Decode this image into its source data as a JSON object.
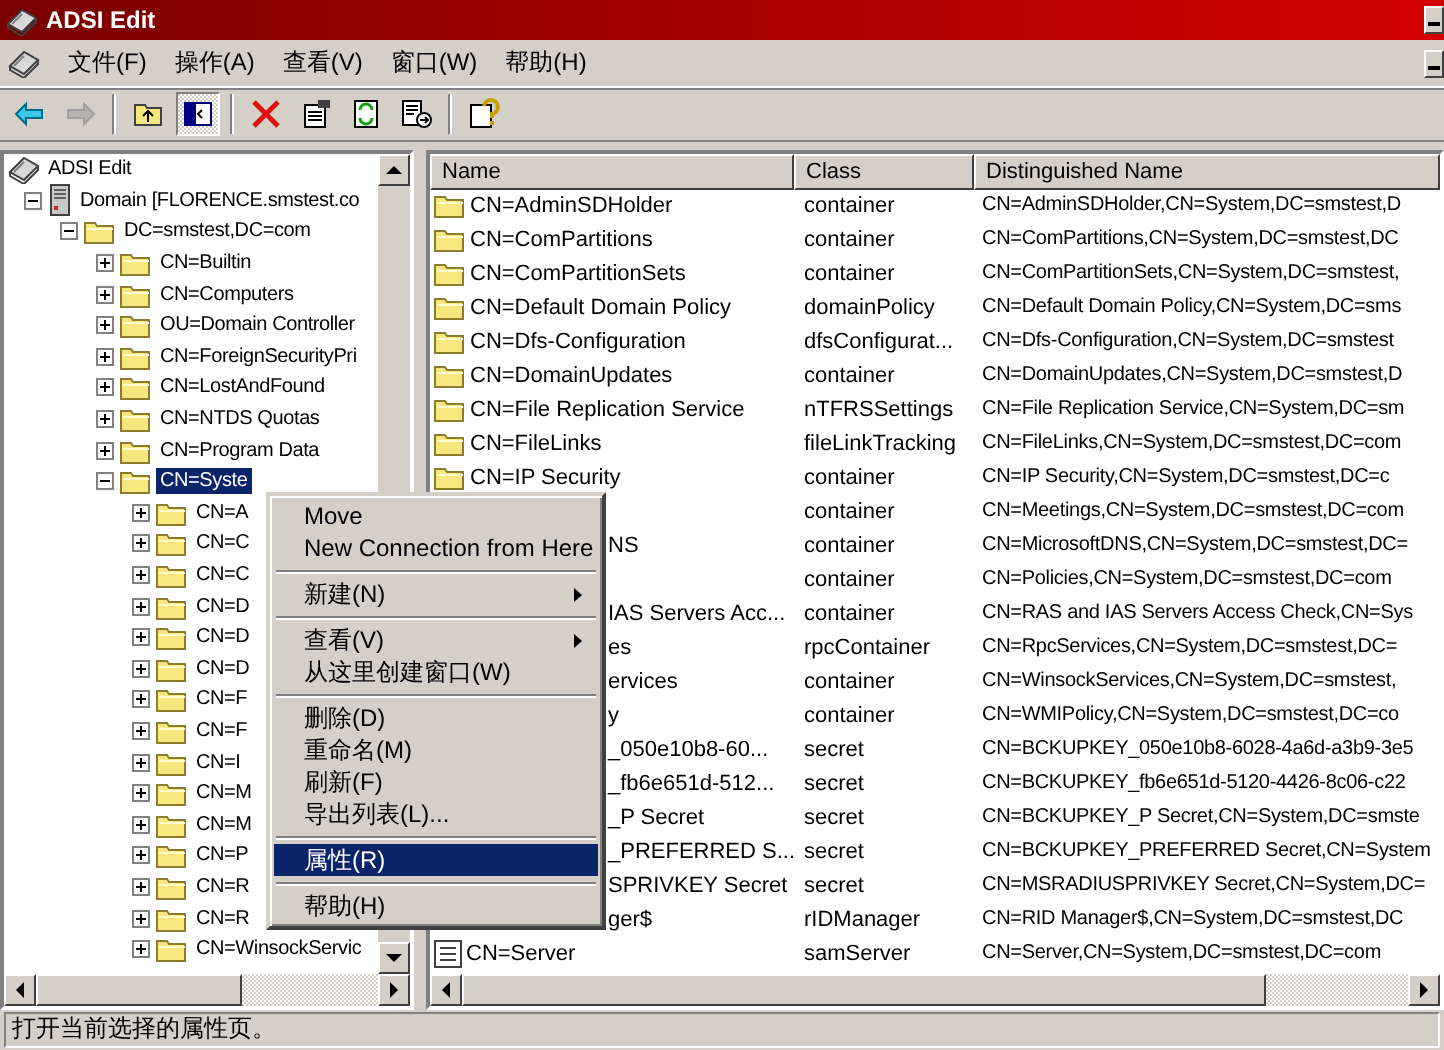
{
  "window": {
    "title": "ADSI Edit"
  },
  "menu_bar": [
    {
      "label": "文件(F)"
    },
    {
      "label": "操作(A)"
    },
    {
      "label": "查看(V)"
    },
    {
      "label": "窗口(W)"
    },
    {
      "label": "帮助(H)"
    }
  ],
  "toolbar": [
    {
      "kind": "back",
      "disabled": false
    },
    {
      "kind": "forward",
      "disabled": true
    },
    {
      "kind": "separator"
    },
    {
      "kind": "up",
      "disabled": false
    },
    {
      "kind": "tree-toggle",
      "disabled": false,
      "pressed": true
    },
    {
      "kind": "separator"
    },
    {
      "kind": "delete",
      "disabled": false
    },
    {
      "kind": "properties",
      "disabled": false
    },
    {
      "kind": "refresh",
      "disabled": false
    },
    {
      "kind": "export",
      "disabled": false
    },
    {
      "kind": "separator"
    },
    {
      "kind": "help",
      "disabled": false
    }
  ],
  "tree": [
    {
      "label": "ADSI Edit",
      "kind": "console",
      "selected": false,
      "children": [
        {
          "label": "Domain [FLORENCE.smstest.co",
          "kind": "server",
          "selected": false,
          "expanded": true,
          "children": [
            {
              "label": "DC=smstest,DC=com",
              "kind": "folder",
              "selected": false,
              "expanded": true,
              "children": [
                {
                  "label": "CN=Builtin",
                  "kind": "folder",
                  "selected": false,
                  "expanded": false
                },
                {
                  "label": "CN=Computers",
                  "kind": "folder",
                  "selected": false,
                  "expanded": false
                },
                {
                  "label": "OU=Domain Controller",
                  "kind": "folder",
                  "selected": false,
                  "expanded": false
                },
                {
                  "label": "CN=ForeignSecurityPri",
                  "kind": "folder",
                  "selected": false,
                  "expanded": false
                },
                {
                  "label": "CN=LostAndFound",
                  "kind": "folder",
                  "selected": false,
                  "expanded": false
                },
                {
                  "label": "CN=NTDS Quotas",
                  "kind": "folder",
                  "selected": false,
                  "expanded": false
                },
                {
                  "label": "CN=Program Data",
                  "kind": "folder",
                  "selected": false,
                  "expanded": false
                },
                {
                  "label": "CN=Syste",
                  "kind": "folder",
                  "selected": true,
                  "expanded": true,
                  "children": [
                    {
                      "label": "CN=A",
                      "kind": "folder",
                      "selected": false,
                      "expanded": false
                    },
                    {
                      "label": "CN=C",
                      "kind": "folder",
                      "selected": false,
                      "expanded": false
                    },
                    {
                      "label": "CN=C",
                      "kind": "folder",
                      "selected": false,
                      "expanded": false
                    },
                    {
                      "label": "CN=D",
                      "kind": "folder",
                      "selected": false,
                      "expanded": false
                    },
                    {
                      "label": "CN=D",
                      "kind": "folder",
                      "selected": false,
                      "expanded": false
                    },
                    {
                      "label": "CN=D",
                      "kind": "folder",
                      "selected": false,
                      "expanded": false
                    },
                    {
                      "label": "CN=F",
                      "kind": "folder",
                      "selected": false,
                      "expanded": false
                    },
                    {
                      "label": "CN=F",
                      "kind": "folder",
                      "selected": false,
                      "expanded": false
                    },
                    {
                      "label": "CN=I",
                      "kind": "folder",
                      "selected": false,
                      "expanded": false
                    },
                    {
                      "label": "CN=M",
                      "kind": "folder",
                      "selected": false,
                      "expanded": false
                    },
                    {
                      "label": "CN=M",
                      "kind": "folder",
                      "selected": false,
                      "expanded": false
                    },
                    {
                      "label": "CN=P",
                      "kind": "folder",
                      "selected": false,
                      "expanded": false
                    },
                    {
                      "label": "CN=R",
                      "kind": "folder",
                      "selected": false,
                      "expanded": false
                    },
                    {
                      "label": "CN=R",
                      "kind": "folder",
                      "selected": false,
                      "expanded": false
                    },
                    {
                      "label": "CN=WinsockServic",
                      "kind": "folder",
                      "selected": false,
                      "expanded": false
                    }
                  ]
                }
              ]
            }
          ]
        }
      ]
    }
  ],
  "table": {
    "columns": [
      "Name",
      "Class",
      "Distinguished Name"
    ],
    "rows": [
      {
        "kind": "folder",
        "covered": false,
        "selected": false,
        "name": "CN=AdminSDHolder",
        "class": "container",
        "dn": "CN=AdminSDHolder,CN=System,DC=smstest,D"
      },
      {
        "kind": "folder",
        "covered": false,
        "selected": false,
        "name": "CN=ComPartitions",
        "class": "container",
        "dn": "CN=ComPartitions,CN=System,DC=smstest,DC"
      },
      {
        "kind": "folder",
        "covered": false,
        "selected": false,
        "name": "CN=ComPartitionSets",
        "class": "container",
        "dn": "CN=ComPartitionSets,CN=System,DC=smstest,"
      },
      {
        "kind": "folder",
        "covered": false,
        "selected": false,
        "name": "CN=Default Domain Policy",
        "class": "domainPolicy",
        "dn": "CN=Default Domain Policy,CN=System,DC=sms"
      },
      {
        "kind": "folder",
        "covered": false,
        "selected": false,
        "name": "CN=Dfs-Configuration",
        "class": "dfsConfigurat...",
        "dn": "CN=Dfs-Configuration,CN=System,DC=smstest"
      },
      {
        "kind": "folder",
        "covered": false,
        "selected": false,
        "name": "CN=DomainUpdates",
        "class": "container",
        "dn": "CN=DomainUpdates,CN=System,DC=smstest,D"
      },
      {
        "kind": "folder",
        "covered": false,
        "selected": false,
        "name": "CN=File Replication Service",
        "class": "nTFRSSettings",
        "dn": "CN=File Replication Service,CN=System,DC=sm"
      },
      {
        "kind": "folder",
        "covered": false,
        "selected": false,
        "name": "CN=FileLinks",
        "class": "fileLinkTracking",
        "dn": "CN=FileLinks,CN=System,DC=smstest,DC=com"
      },
      {
        "kind": "folder",
        "covered": false,
        "selected": false,
        "name": "CN=IP Security",
        "class": "container",
        "dn": "CN=IP Security,CN=System,DC=smstest,DC=c"
      },
      {
        "selected": false,
        "class": "container",
        "dn": "CN=Meetings,CN=System,DC=smstest,DC=com"
      },
      {
        "covered": true,
        "selected": false,
        "name": "NS",
        "class": "container",
        "dn": "CN=MicrosoftDNS,CN=System,DC=smstest,DC="
      },
      {
        "selected": false,
        "class": "container",
        "dn": "CN=Policies,CN=System,DC=smstest,DC=com"
      },
      {
        "covered": true,
        "selected": false,
        "name": "IAS Servers Acc...",
        "class": "container",
        "dn": "CN=RAS and IAS Servers Access Check,CN=Sys"
      },
      {
        "covered": true,
        "selected": false,
        "name": "es",
        "class": "rpcContainer",
        "dn": "CN=RpcServices,CN=System,DC=smstest,DC="
      },
      {
        "covered": true,
        "selected": false,
        "name": "ervices",
        "class": "container",
        "dn": "CN=WinsockServices,CN=System,DC=smstest,"
      },
      {
        "covered": true,
        "selected": false,
        "name": "y",
        "class": "container",
        "dn": "CN=WMIPolicy,CN=System,DC=smstest,DC=co"
      },
      {
        "covered": true,
        "selected": false,
        "name": "_050e10b8-60...",
        "class": "secret",
        "dn": "CN=BCKUPKEY_050e10b8-6028-4a6d-a3b9-3e5"
      },
      {
        "covered": true,
        "selected": false,
        "name": "_fb6e651d-512...",
        "class": "secret",
        "dn": "CN=BCKUPKEY_fb6e651d-5120-4426-8c06-c22"
      },
      {
        "covered": true,
        "selected": false,
        "name": "_P Secret",
        "class": "secret",
        "dn": "CN=BCKUPKEY_P Secret,CN=System,DC=smste"
      },
      {
        "covered": true,
        "selected": false,
        "name": "_PREFERRED S...",
        "class": "secret",
        "dn": "CN=BCKUPKEY_PREFERRED Secret,CN=System"
      },
      {
        "covered": true,
        "selected": false,
        "name": "SPRIVKEY Secret",
        "class": "secret",
        "dn": "CN=MSRADIUSPRIVKEY Secret,CN=System,DC="
      },
      {
        "covered": true,
        "selected": false,
        "name": "ger$",
        "class": "rIDManager",
        "dn": "CN=RID Manager$,CN=System,DC=smstest,DC"
      },
      {
        "kind": "object",
        "covered": false,
        "selected": false,
        "name": "CN=Server",
        "class": "samServer",
        "dn": "CN=Server,CN=System,DC=smstest,DC=com"
      }
    ]
  },
  "context_menu": {
    "items": [
      {
        "kind": "item",
        "label": "Move",
        "selected": false
      },
      {
        "kind": "item",
        "label": "New Connection from Here",
        "selected": false
      },
      {
        "kind": "separator"
      },
      {
        "kind": "submenu",
        "label": "新建(N)",
        "selected": false
      },
      {
        "kind": "separator"
      },
      {
        "kind": "submenu",
        "label": "查看(V)",
        "selected": false
      },
      {
        "kind": "item",
        "label": "从这里创建窗口(W)",
        "selected": false
      },
      {
        "kind": "separator"
      },
      {
        "kind": "item",
        "label": "删除(D)",
        "selected": false
      },
      {
        "kind": "item",
        "label": "重命名(M)",
        "selected": false
      },
      {
        "kind": "item",
        "label": "刷新(F)",
        "selected": false
      },
      {
        "kind": "item",
        "label": "导出列表(L)...",
        "selected": false
      },
      {
        "kind": "separator"
      },
      {
        "kind": "item",
        "label": "属性(R)",
        "selected": true
      },
      {
        "kind": "separator"
      },
      {
        "kind": "item",
        "label": "帮助(H)",
        "selected": false
      }
    ]
  },
  "status_bar": {
    "text": "打开当前选择的属性页。"
  }
}
